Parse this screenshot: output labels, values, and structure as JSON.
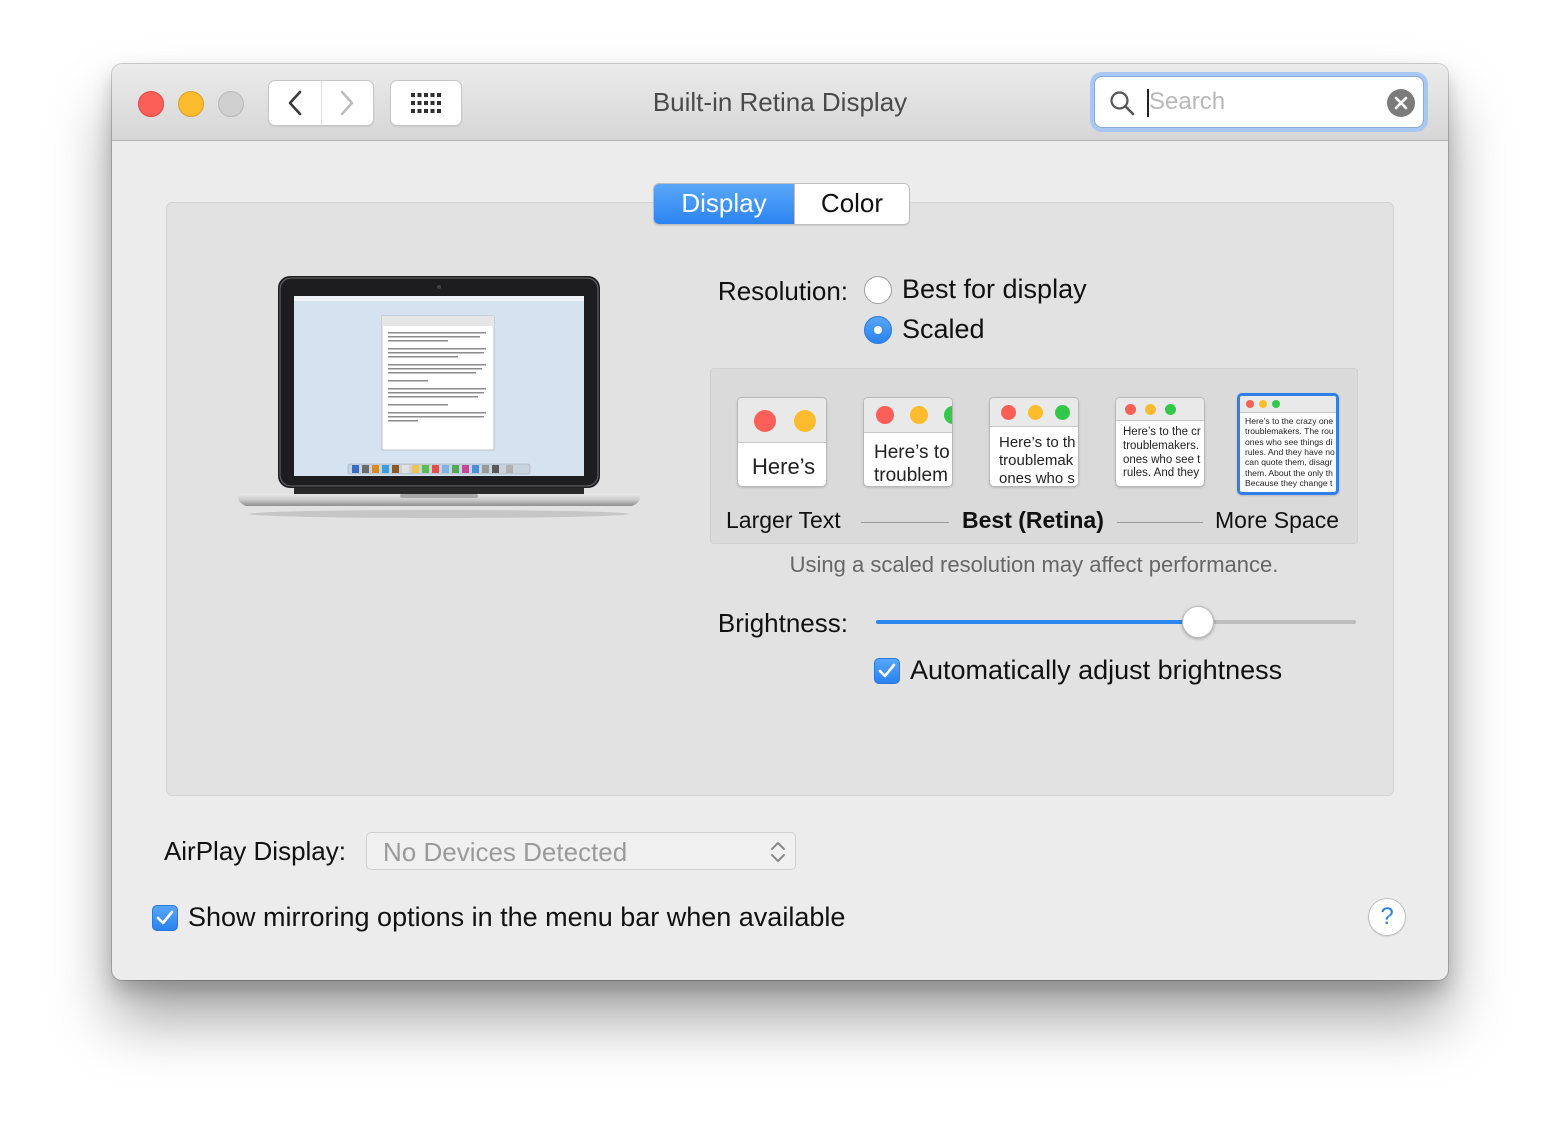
{
  "window": {
    "title": "Built-in Retina Display"
  },
  "search": {
    "placeholder": "Search",
    "value": ""
  },
  "tabs": [
    {
      "label": "Display",
      "selected": true
    },
    {
      "label": "Color",
      "selected": false
    }
  ],
  "resolution": {
    "label": "Resolution:",
    "options": [
      {
        "label": "Best for display",
        "selected": false
      },
      {
        "label": "Scaled",
        "selected": true
      }
    ],
    "scale_labels": {
      "left": "Larger Text",
      "middle": "Best (Retina)",
      "right": "More Space"
    },
    "thumbnails": [
      {
        "text": "Here’s"
      },
      {
        "text": "Here’s to\ntroublem"
      },
      {
        "text": "Here’s to th\ntroublemak\nones who s"
      },
      {
        "text": "Here’s to the cr\ntroublemakers.\nones who see t\nrules. And they"
      },
      {
        "text": "Here’s to the crazy one\ntroublemakers. The rou\nones who see things di\nrules. And they have no\ncan quote them, disagr\nthem. About the only th\nBecause they change t"
      }
    ],
    "selected_index": 4,
    "note": "Using a scaled resolution may affect performance."
  },
  "brightness": {
    "label": "Brightness:",
    "level": 0.67,
    "auto_label": "Automatically adjust brightness",
    "auto_checked": true
  },
  "airplay": {
    "label": "AirPlay Display:",
    "value": "No Devices Detected"
  },
  "mirroring": {
    "label": "Show mirroring options in the menu bar when available",
    "checked": true
  },
  "help": {
    "label": "?"
  },
  "colors": {
    "accent": "#2e87f0",
    "close": "#fc5f57",
    "minimize": "#fdbc2e",
    "zoom_disabled": "#d0d0d0"
  }
}
